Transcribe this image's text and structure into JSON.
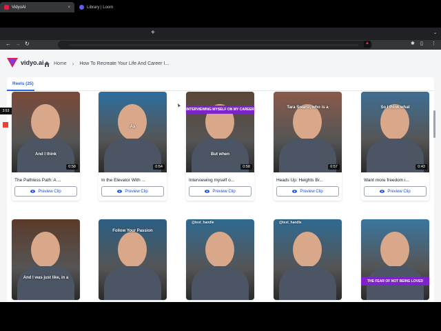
{
  "browser": {
    "active_tab": "VidyoAI",
    "inactive_tab": "Library | Loom",
    "new_tab_symbol": "+",
    "close_symbol": "×",
    "menu_symbol": "⌄"
  },
  "header": {
    "logo_text": "vidyo.ai",
    "home_label": "Home",
    "page_title": "How To Recreate Your Life And Career I...",
    "chevron": "›"
  },
  "tabs": {
    "reels_label": "Reels (25)"
  },
  "recorder": {
    "timer": "3:53"
  },
  "cards": [
    {
      "title": "The Pathless Path: A ...",
      "duration": "0:58",
      "caption": "And I think",
      "button": "Preview Clip",
      "bg": "#7a4a3a"
    },
    {
      "title": "In the Elevator With ...",
      "duration": "0:54",
      "caption": "As",
      "button": "Preview Clip",
      "bg": "#2d6f9e"
    },
    {
      "title": "Interviewing myself o...",
      "duration": "0:58",
      "caption": "But when",
      "banner": "INTERVIEWING MYSELF ON MY CAREER",
      "button": "Preview Clip",
      "bg": "#5a4636"
    },
    {
      "title": "Heads Up: Heights Br...",
      "duration": "0:57",
      "caption": "Tara Swartz, who is a",
      "button": "Preview Clip",
      "bg": "#8a5a4a"
    },
    {
      "title": "Want more freedom i...",
      "duration": "0:43",
      "caption": "So I think what",
      "button": "Preview Clip",
      "bg": "#3f6e93"
    },
    {
      "caption": "And I was just like, in a",
      "bg": "#5b3a2a"
    },
    {
      "caption": "Follow Your Passion",
      "bg": "#2a5f85"
    },
    {
      "caption": "@test_handle",
      "bg": "#2f6a92"
    },
    {
      "caption": "@test_handle",
      "bg": "#2f6a92"
    },
    {
      "caption": "THE FEAR OF NOT BEING LOVED",
      "bg": "#3a76a0"
    }
  ]
}
